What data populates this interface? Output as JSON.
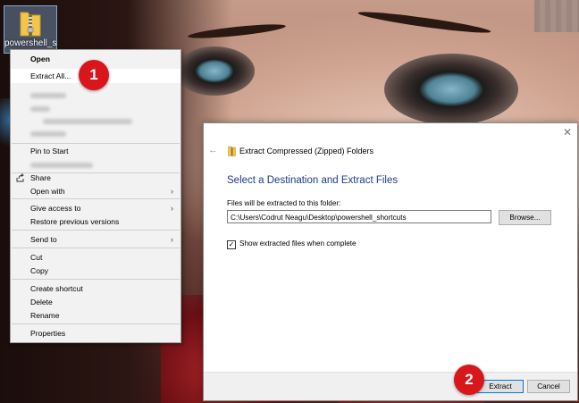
{
  "desktop": {
    "icon_label": "powershell_s"
  },
  "context_menu": {
    "items": [
      {
        "label": "Open",
        "bold": true
      },
      {
        "label": "Extract All...",
        "highlighted": true
      },
      {
        "label": "Pin to Start"
      },
      {
        "label": "Share",
        "icon": "share-icon"
      },
      {
        "label": "Open with",
        "submenu": true
      },
      {
        "label": "Give access to",
        "submenu": true
      },
      {
        "label": "Restore previous versions"
      },
      {
        "label": "Send to",
        "submenu": true
      },
      {
        "label": "Cut"
      },
      {
        "label": "Copy"
      },
      {
        "label": "Create shortcut"
      },
      {
        "label": "Delete"
      },
      {
        "label": "Rename"
      },
      {
        "label": "Properties"
      }
    ],
    "submenu_glyph": "›"
  },
  "callouts": {
    "step1": "1",
    "step2": "2"
  },
  "dialog": {
    "title": "Extract Compressed (Zipped) Folders",
    "heading": "Select a Destination and Extract Files",
    "destination_label": "Files will be extracted to this folder:",
    "destination_path": "C:\\Users\\Codrut Neagu\\Desktop\\powershell_shortcuts",
    "browse_label": "Browse...",
    "show_files_label": "Show extracted files when complete",
    "show_files_checked": true,
    "extract_label": "Extract",
    "cancel_label": "Cancel",
    "close_glyph": "✕",
    "back_glyph": "←",
    "checkmark_glyph": "✓"
  },
  "colors": {
    "callout": "#d8161b",
    "heading": "#1e3b8c",
    "primary_border": "#0078d7"
  }
}
